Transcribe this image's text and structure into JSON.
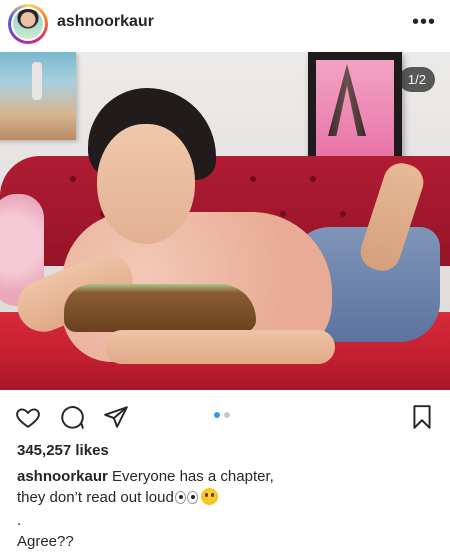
{
  "post": {
    "username": "ashnoorkaur",
    "more_icon": "more-horizontal-icon",
    "image_counter": "1/2",
    "likes": "345,257 likes",
    "caption_user": "ashnoorkaur",
    "caption_line1": "Everyone has a chapter,",
    "caption_line2": "they don’t read out loud",
    "caption_line3": ".",
    "caption_line4": "Agree??"
  },
  "actions": {
    "like_icon": "heart-icon",
    "comment_icon": "comment-icon",
    "share_icon": "send-icon",
    "save_icon": "bookmark-icon"
  },
  "carousel": {
    "total": 2,
    "active": 1
  },
  "colors": {
    "accent_dot": "#3897f0",
    "text": "#262626"
  }
}
